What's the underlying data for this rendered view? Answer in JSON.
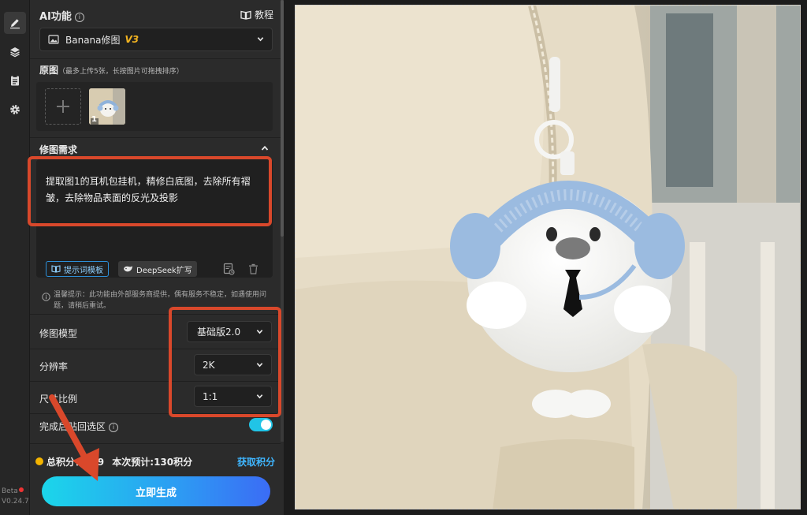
{
  "sidebar": {
    "version_label": "Beta",
    "version": "V0.24.7"
  },
  "ai_feature": {
    "title": "AI功能",
    "tutorial_label": "教程",
    "model_name": "Banana修图",
    "model_tag": "V3"
  },
  "source_images": {
    "title": "原图",
    "hint": "（最多上传5张，长按图片可拖拽排序）",
    "thumb_index": "1"
  },
  "request": {
    "title": "修图需求",
    "text": "提取图1的耳机包挂机，精修白底图，去除所有褶皱，去除物品表面的反光及投影",
    "template_label": "提示词模板",
    "deepseek_label": "DeepSeek扩写"
  },
  "notice": {
    "text": "温馨提示：此功能由外部服务商提供，偶有服务不稳定，如遇使用问题，请稍后重试。"
  },
  "settings": {
    "model_label": "修图模型",
    "model_value": "基础版2.0",
    "resolution_label": "分辨率",
    "resolution_value": "2K",
    "ratio_label": "尺寸比例",
    "ratio_value": "1:1",
    "paste_back_label": "完成后贴回选区",
    "paste_back_on": true
  },
  "points": {
    "total_label": "总积分：",
    "total_value": "339",
    "estimate_label": "本次预计:",
    "estimate_value": "130积分",
    "get_points_label": "获取积分"
  },
  "generate_label": "立即生成",
  "colors": {
    "accent_cyan": "#21c4e6",
    "annotation_red": "#d9482b",
    "points_link": "#3fb6ff",
    "coin_gold": "#f4b400"
  }
}
